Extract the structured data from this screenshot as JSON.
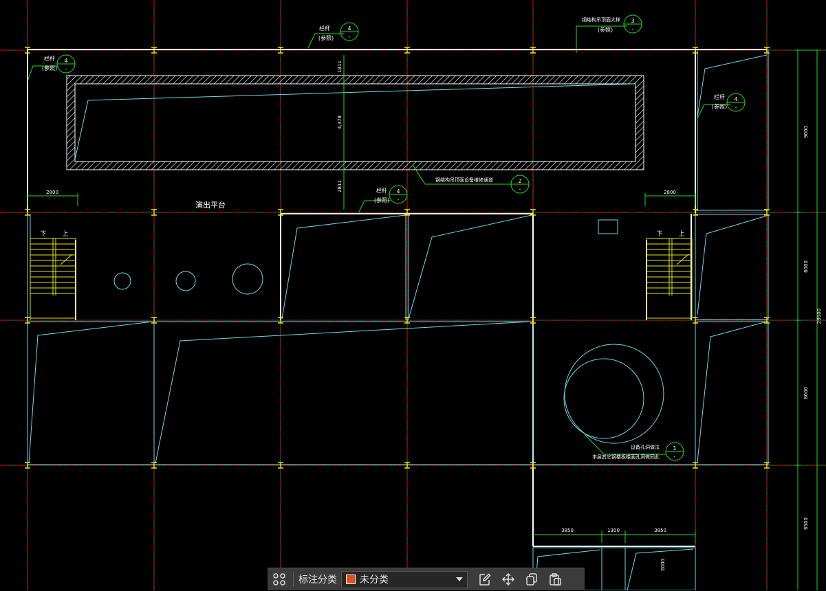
{
  "colors": {
    "background": "#000000",
    "axis_line": "#d01515",
    "grid_green": "#1f8a1f",
    "wall_white": "#ffffff",
    "beam_cyan": "#6fd8e8",
    "stair_yellow": "#e6e600",
    "leader_green": "#22dd22",
    "tag_text": "#ffffff",
    "swatch": "#e2501a"
  },
  "drawing": {
    "tags": {
      "t1": {
        "label": "栏杆",
        "sub": "(参照)",
        "num": "4",
        "den": "-"
      },
      "t2": {
        "label": "钢结构吊顶面大样",
        "sub": "(参照)",
        "num": "3",
        "den": "-"
      },
      "t3": {
        "label": "栏杆",
        "sub": "(参照)",
        "num": "4",
        "den": "-"
      },
      "t4": {
        "label": "栏杆",
        "sub": "(参照)",
        "num": "4",
        "den": "-"
      },
      "t5": {
        "label": "钢结构吊顶面设备维修通道",
        "num": "2",
        "den": "-"
      },
      "t6": {
        "label": "栏杆",
        "sub": "(参照)",
        "num": "4",
        "den": "-"
      },
      "t7": {
        "label": "设备孔洞做法",
        "sub": "本层其它钢楼板楼面孔洞做同此",
        "num": "1",
        "den": "-"
      }
    },
    "labels": {
      "platform": "演出平台",
      "stair_down_left": "下",
      "stair_up_left": "上",
      "stair_down_right": "下",
      "stair_up_right": "上"
    },
    "dims": {
      "left_2800": "2800",
      "right_2800": "2800",
      "v_4378": "4,378",
      "v_top": "1811",
      "v_mid": "2811",
      "d_9000": "9000",
      "d_6000": "6000",
      "d_29500": "29500",
      "d_8000": "8000",
      "d_6500": "6500",
      "b_3850a": "3850",
      "b_1300": "1300",
      "b_3850b": "3850",
      "b_2000": "2000"
    }
  },
  "toolbar": {
    "grid_icon": "grid-icon",
    "label": "标注分类",
    "select_value": "未分类",
    "edit_icon": "edit-icon",
    "move_icon": "move-icon",
    "copy_icon": "copy-icon",
    "paste_icon": "paste-icon"
  }
}
